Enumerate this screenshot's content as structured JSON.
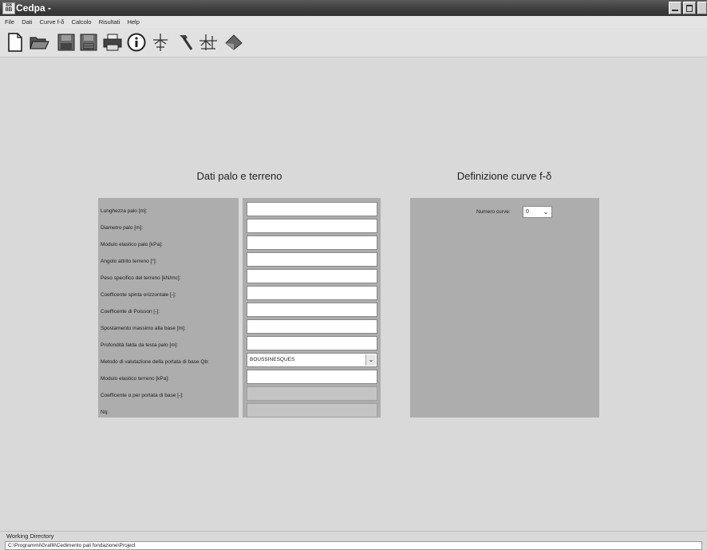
{
  "window": {
    "title": "Cedpa -",
    "app_icon_text": "88 8B"
  },
  "menu": [
    "File",
    "Dati",
    "Curve f-δ",
    "Calcolo",
    "Risultati",
    "Help"
  ],
  "toolbar": [
    {
      "icon": "new-document-icon"
    },
    {
      "icon": "open-folder-icon"
    },
    {
      "icon": "save-icon"
    },
    {
      "icon": "save-as-icon"
    },
    {
      "icon": "print-icon"
    },
    {
      "icon": "info-icon"
    },
    {
      "icon": "pile-icon"
    },
    {
      "icon": "hammer-icon"
    },
    {
      "icon": "pile-curves-icon"
    },
    {
      "icon": "eraser-icon"
    }
  ],
  "left_panel": {
    "title": "Dati palo e terreno",
    "labels": [
      "Lunghezza palo [m]:",
      "Diametro palo [m]:",
      "Modulo elastico palo [kPa]:",
      "Angolo attrito terreno [°]:",
      "Peso specifico del terreno [kN/mc]:",
      "Coefficente spinta orizzontale [-]:",
      "Coefficente di Poisson [-]:",
      "Spostamento massimo alla base [m]:",
      "Profondità falda da testa palo [m]:",
      "Metodo di valutazione della portata di base Qb:",
      "Modulo elastico terreno [kPa]:",
      "Coefficente α per portata di base [-]:",
      "Nq:"
    ],
    "method_value": "BOUSSINESQUES"
  },
  "right_panel": {
    "title": "Definizione curve f-δ",
    "curves_label": "Numero curve:",
    "curves_value": "0"
  },
  "status": {
    "label": "Working Directory",
    "path": "C:\\Programmi\\Grafill\\Cedimento pali fondazione\\Project"
  }
}
